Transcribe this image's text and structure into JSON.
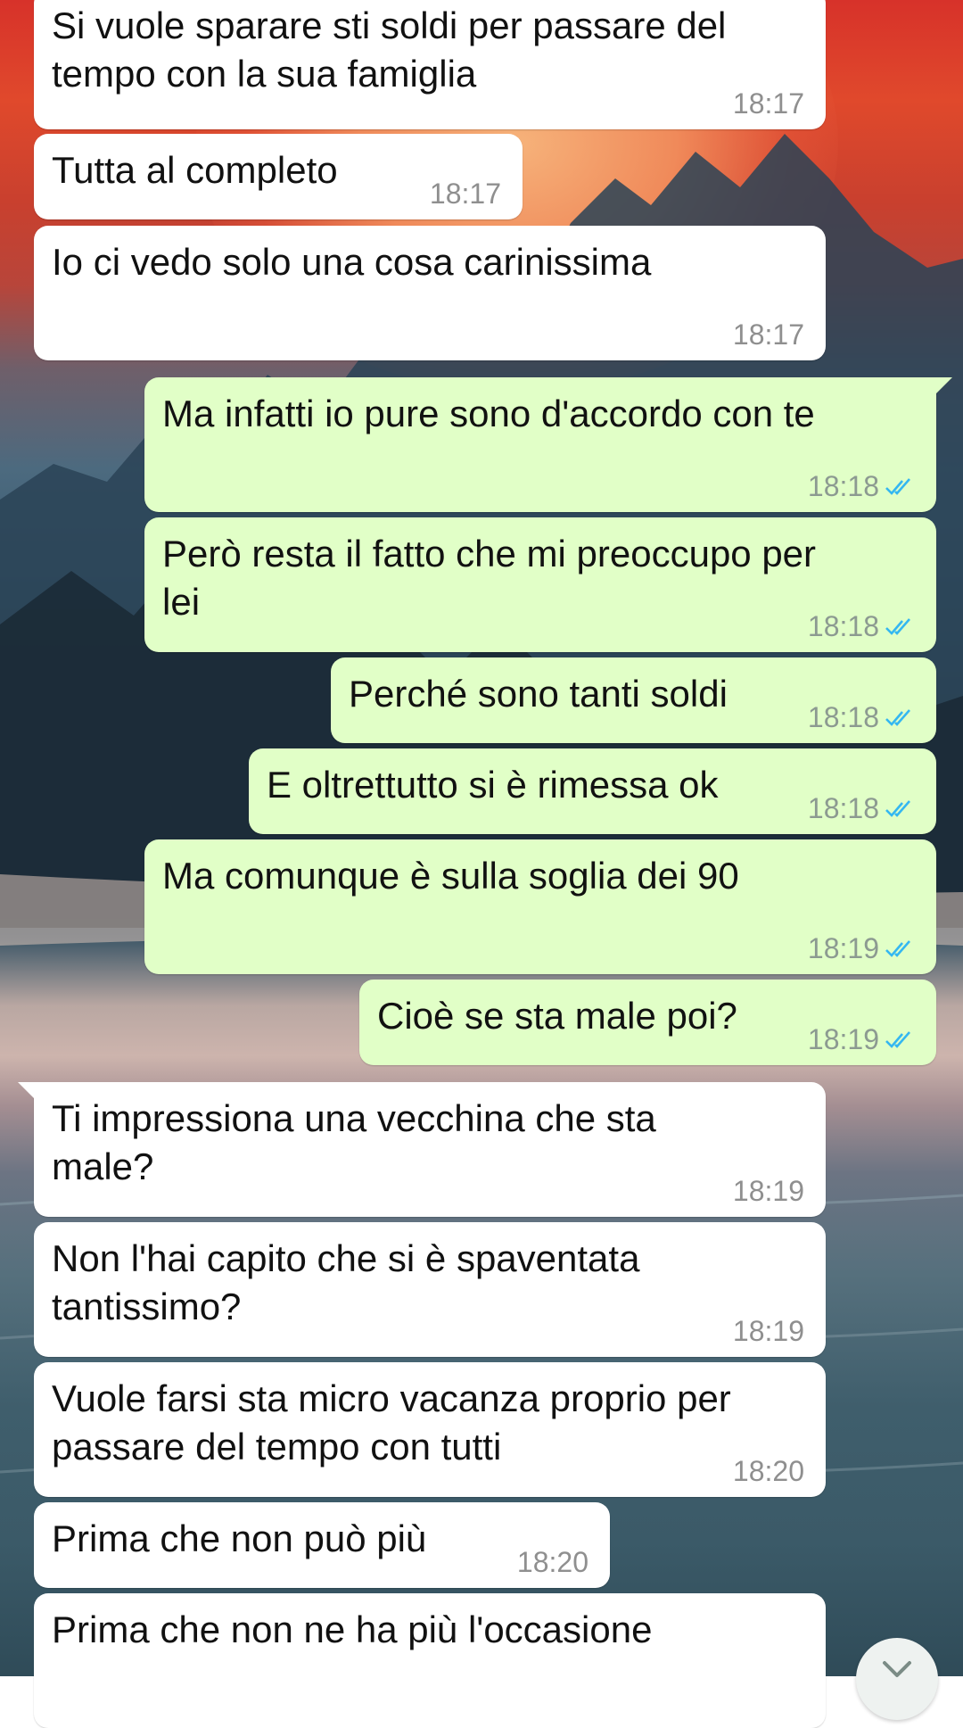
{
  "messages": [
    {
      "dir": "in",
      "text": "Si vuole sparare sti soldi per passare del\ntempo con la sua famiglia",
      "time": "18:17"
    },
    {
      "dir": "in",
      "text": "Tutta al completo",
      "time": "18:17"
    },
    {
      "dir": "in",
      "text": "Io ci vedo solo una cosa carinissima",
      "time": "18:17"
    },
    {
      "dir": "out",
      "text": "Ma infatti io pure sono d'accordo con te",
      "time": "18:18",
      "status": "read"
    },
    {
      "dir": "out",
      "text": "Però resta il fatto che mi preoccupo per\nlei",
      "time": "18:18",
      "status": "read"
    },
    {
      "dir": "out",
      "text": "Perché sono tanti soldi",
      "time": "18:18",
      "status": "read"
    },
    {
      "dir": "out",
      "text": "E oltrettutto si è rimessa ok",
      "time": "18:18",
      "status": "read"
    },
    {
      "dir": "out",
      "text": "Ma comunque è sulla soglia dei 90",
      "time": "18:19",
      "status": "read"
    },
    {
      "dir": "out",
      "text": "Cioè se sta male poi?",
      "time": "18:19",
      "status": "read"
    },
    {
      "dir": "in",
      "text": "Ti impressiona una vecchina che sta\nmale?",
      "time": "18:19"
    },
    {
      "dir": "in",
      "text": "Non l'hai capito che si è spaventata\ntantissimo?",
      "time": "18:19"
    },
    {
      "dir": "in",
      "text": "Vuole farsi sta micro vacanza proprio per\npassare del tempo con tutti",
      "time": "18:20"
    },
    {
      "dir": "in",
      "text": "Prima che non può più",
      "time": "18:20"
    },
    {
      "dir": "in",
      "text": "Prima che non ne ha più l'occasione",
      "time": ""
    }
  ],
  "colors": {
    "incoming_bubble": "#ffffff",
    "outgoing_bubble": "#e1ffc7",
    "read_ticks": "#34b7f1"
  },
  "icons": {
    "read_status": "double-check-icon",
    "scroll_down": "chevron-down-icon"
  }
}
